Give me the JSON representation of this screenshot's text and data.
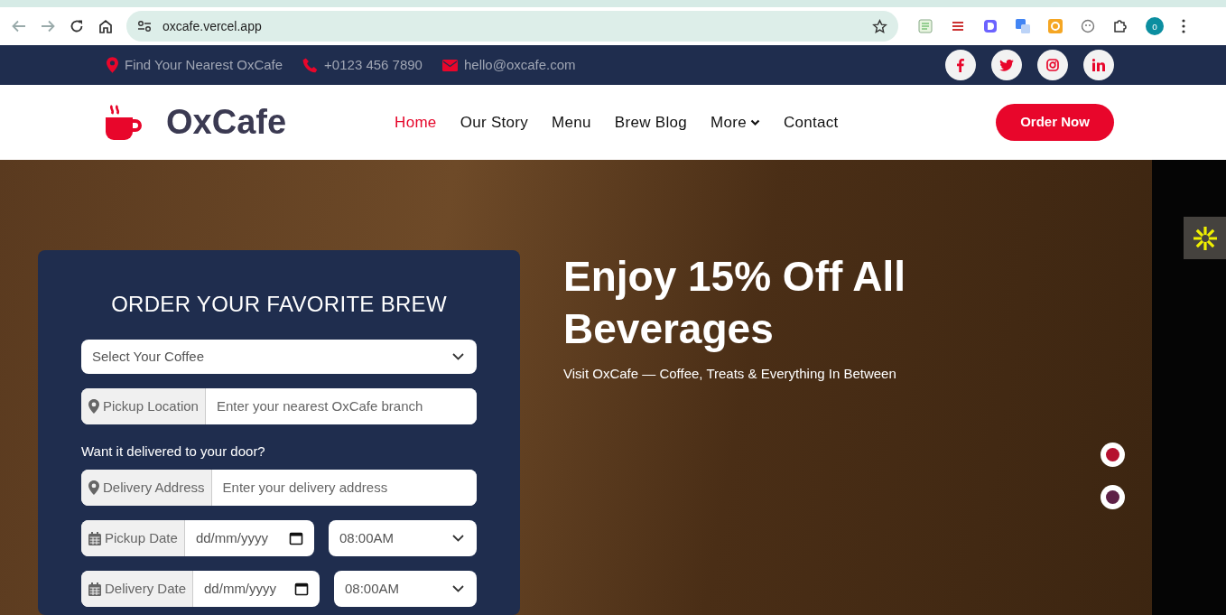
{
  "browser": {
    "url": "oxcafe.vercel.app",
    "profile": "o"
  },
  "topbar": {
    "contacts": [
      "Find Your Nearest OxCafe",
      "+0123 456 7890",
      "hello@oxcafe.com"
    ]
  },
  "nav": {
    "logo": "OxCafe",
    "items": [
      {
        "label": "Home",
        "selected": true,
        "dropdown": false
      },
      {
        "label": "Our Story",
        "selected": false,
        "dropdown": false
      },
      {
        "label": "Menu",
        "selected": false,
        "dropdown": false
      },
      {
        "label": "Brew Blog",
        "selected": false,
        "dropdown": false
      },
      {
        "label": "More",
        "selected": false,
        "dropdown": true
      },
      {
        "label": "Contact",
        "selected": false,
        "dropdown": false
      }
    ],
    "cta": "Order Now"
  },
  "form": {
    "title": "ORDER YOUR FAVORITE BREW",
    "coffee_select": "Select Your Coffee",
    "pickup_location": {
      "label": "Pickup Location",
      "placeholder": "Enter your nearest OxCafe branch"
    },
    "delivery_prompt": "Want it delivered to your door?",
    "delivery_address": {
      "label": "Delivery Address",
      "placeholder": "Enter your delivery address"
    },
    "pickup_date": {
      "label": "Pickup Date",
      "value": "dd/mm/yyyy",
      "time": "08:00AM"
    },
    "delivery_date": {
      "label": "Delivery Date",
      "value": "dd/mm/yyyy",
      "time": "08:00AM"
    }
  },
  "hero": {
    "headline": "Enjoy 15% Off All Beverages",
    "subline": "Visit OxCafe — Coffee, Treats & Everything In Between",
    "slides": [
      {
        "selected": true
      },
      {
        "selected": false
      }
    ]
  }
}
